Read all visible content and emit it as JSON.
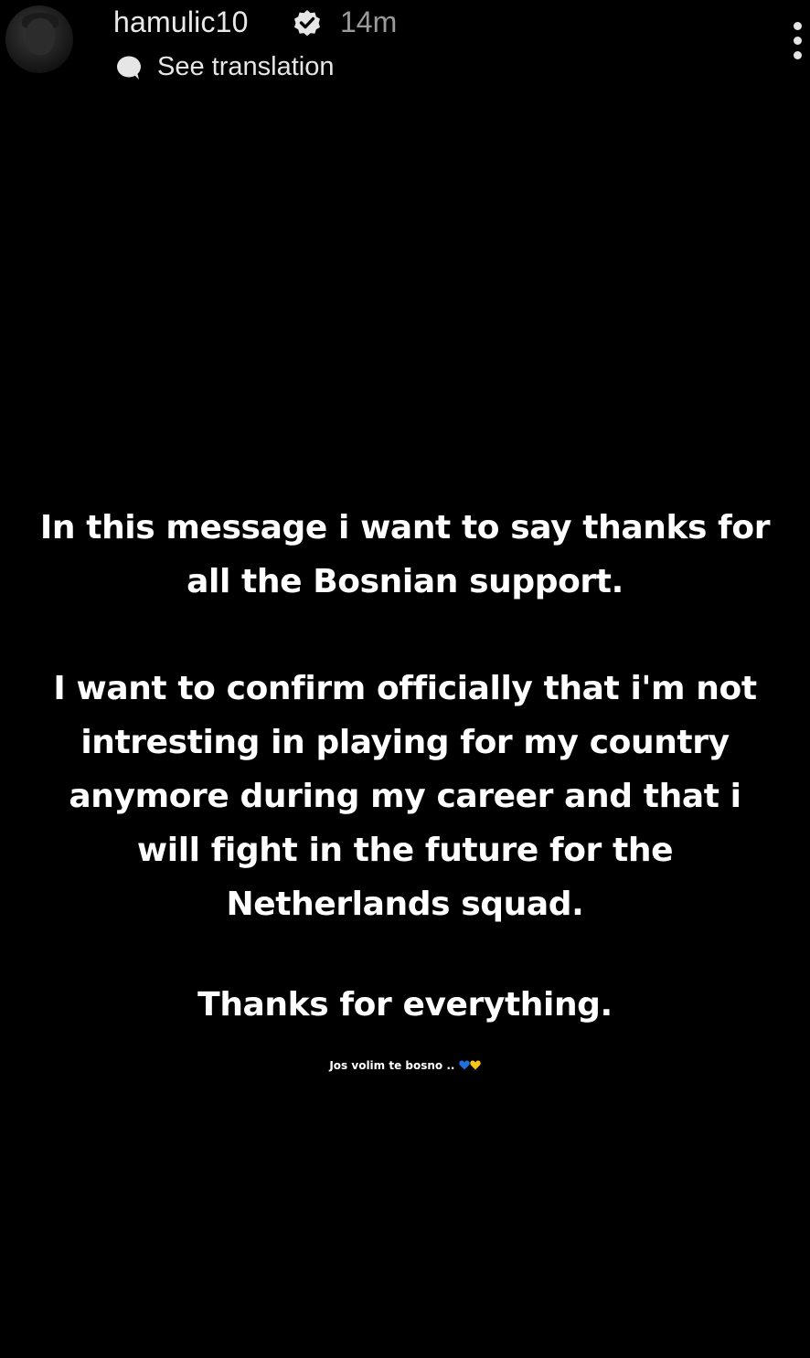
{
  "header": {
    "username": "hamulic10",
    "time": "14m",
    "translation_label": "See translation"
  },
  "message": {
    "paragraph1": "In this message i want to say thanks for all the Bosnian support.",
    "paragraph2": "I want to confirm officially that i'm not intresting in playing for my country anymore during my career and that i will fight in the future for the Netherlands squad.",
    "paragraph3": "Thanks for everything.",
    "signoff": "Jos volim te bosno .."
  },
  "icons": {
    "avatar": "profile-avatar",
    "verified": "verified-badge-icon",
    "translate": "speech-bubble-icon",
    "more": "more-options-icon",
    "hearts": [
      "blue-heart-icon",
      "yellow-heart-icon"
    ]
  },
  "colors": {
    "background": "#000000",
    "heart_blue": "#1f6fe0",
    "heart_yellow": "#f5c518"
  }
}
